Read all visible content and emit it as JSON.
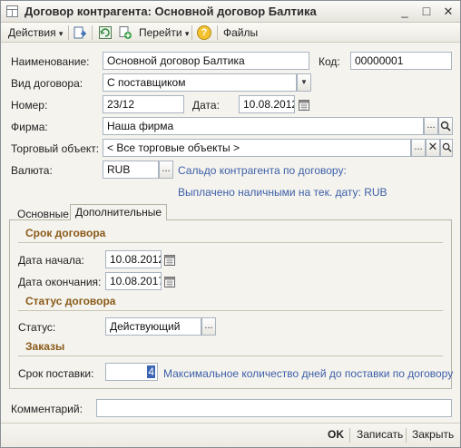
{
  "window": {
    "title": "Договор контрагента: Основной договор Балтика",
    "minimize_glyph": "_",
    "maximize_glyph": "□",
    "close_glyph": "✕"
  },
  "toolbar": {
    "actions_label": "Действия",
    "goto_label": "Перейти",
    "help_glyph": "?",
    "files_label": "Файлы",
    "dropdown_glyph": "▾"
  },
  "form": {
    "name_label": "Наименование:",
    "name_value": "Основной договор Балтика",
    "code_label": "Код:",
    "code_value": "00000001",
    "kind_label": "Вид договора:",
    "kind_value": "С поставщиком",
    "number_label": "Номер:",
    "number_value": "23/12",
    "date_label": "Дата:",
    "date_value": "10.08.2012",
    "firm_label": "Фирма:",
    "firm_value": "Наша фирма",
    "trade_label": "Торговый объект:",
    "trade_value": "< Все торговые объекты >",
    "currency_label": "Валюта:",
    "currency_value": "RUB",
    "balance_link": "Сальдо контрагента по договору:",
    "cash_link": "Выплачено наличными на тек. дату:  RUB",
    "select_glyph": "...",
    "dropdown_glyph": "▼"
  },
  "tabs": [
    {
      "label": "Основные"
    },
    {
      "label": "Дополнительные"
    }
  ],
  "extra": {
    "term_section": "Срок договора",
    "start_label": "Дата начала:",
    "start_value": "10.08.2012",
    "end_label": "Дата окончания:",
    "end_value": "10.08.2017",
    "status_section": "Статус договора",
    "status_label": "Статус:",
    "status_value": "Действующий",
    "orders_section": "Заказы",
    "delivery_label": "Срок поставки:",
    "delivery_value": "4",
    "delivery_hint": "Максимальное количество дней до поставки по договору"
  },
  "comment": {
    "label": "Комментарий:",
    "value": ""
  },
  "footer": {
    "ok_label": "OK",
    "save_label": "Записать",
    "close_label": "Закрыть"
  },
  "colors": {
    "link": "#3d5fa8",
    "section_title": "#8a5a19",
    "field_border": "#a9b3bf"
  }
}
